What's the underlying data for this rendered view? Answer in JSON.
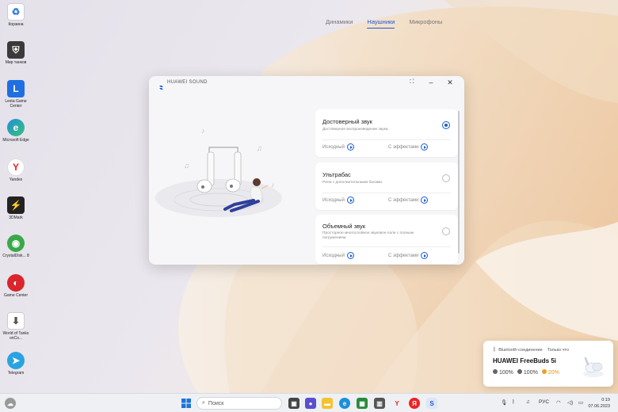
{
  "desktop": {
    "icons": [
      {
        "label": "Корзина",
        "icon": "recycle-bin-icon",
        "color": "#ffffff"
      },
      {
        "label": "Мир танков",
        "icon": "tank-game-icon",
        "color": "#3a3a3a"
      },
      {
        "label": "Lesta Game Center",
        "icon": "lesta-icon",
        "color": "#1f6fe0"
      },
      {
        "label": "Microsoft Edge",
        "icon": "edge-icon",
        "color": "#1e8fd8"
      },
      {
        "label": "Yandex",
        "icon": "yandex-icon",
        "color": "#ffffff"
      },
      {
        "label": "3DMark",
        "icon": "3dmark-icon",
        "color": "#222222"
      },
      {
        "label": "CrystalDisk... 8",
        "icon": "crystaldisk-icon",
        "color": "#3aa84a"
      },
      {
        "label": "Game Center",
        "icon": "game-center-icon",
        "color": "#d8262c"
      },
      {
        "label": "World of Tanks onCo...",
        "icon": "wot-icon",
        "color": "#ffffff"
      },
      {
        "label": "Telegram",
        "icon": "telegram-icon",
        "color": "#2aa3e0"
      }
    ]
  },
  "window": {
    "title": "HUAWEI SOUND",
    "tabs": [
      {
        "label": "Динамики",
        "active": false
      },
      {
        "label": "Наушники",
        "active": true
      },
      {
        "label": "Микрофоны",
        "active": false
      }
    ],
    "cards": [
      {
        "title": "Достоверный звук",
        "desc": "Достоверное воспроизведение звука.",
        "selected": true,
        "opt1": "Исходный",
        "opt2": "С эффектами"
      },
      {
        "title": "Ультрабас",
        "desc": "Ритм с дополнительными басами.",
        "selected": false,
        "opt1": "Исходный",
        "opt2": "С эффектами"
      },
      {
        "title": "Объемный звук",
        "desc": "Просторное многослойное звуковое поле с полным погружением.",
        "selected": false,
        "opt1": "Исходный",
        "opt2": "С эффектами"
      }
    ]
  },
  "notification": {
    "header": "Bluetooth-соединение",
    "time": "Только что",
    "device": "HUAWEI FreeBuds 5i",
    "left": "100%",
    "right": "100%",
    "case": "20%",
    "colors": {
      "left": "#666666",
      "right": "#666666",
      "case": "#f0a020"
    }
  },
  "taskbar": {
    "search_label": "Поиск",
    "lang": "РУС",
    "time": "0:19",
    "date": "07.06.2023"
  },
  "accent": "#1c5bd6"
}
